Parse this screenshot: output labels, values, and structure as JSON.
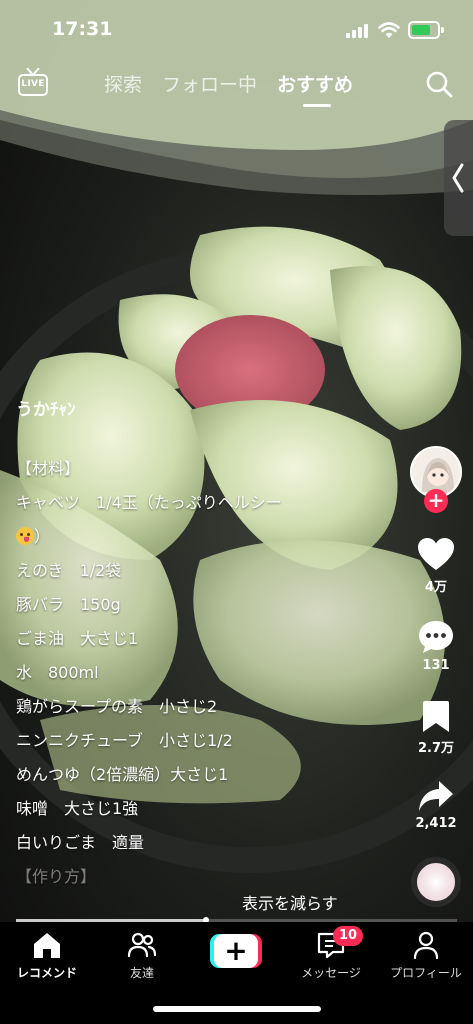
{
  "status_bar": {
    "time": "17:31"
  },
  "top_nav": {
    "live_label": "LIVE",
    "tabs": [
      {
        "label": "探索",
        "active": false
      },
      {
        "label": "フォロー中",
        "active": false
      },
      {
        "label": "おすすめ",
        "active": true
      }
    ]
  },
  "post": {
    "author": "うかﾁｬﾝ",
    "description_lines": [
      "【材料】",
      "キャベツ　1/4玉（たっぷりヘルシー",
      "）",
      "えのき　1/2袋",
      "豚バラ　150g",
      "ごま油　大さじ1",
      "水　800ml",
      "鶏がらスープの素　小さじ2",
      "ニンニクチューブ　小さじ1/2",
      "めんつゆ（2倍濃縮）大さじ1",
      "味噌　大さじ1強",
      "白いりごま　適量",
      "【作り方】"
    ],
    "show_less": "表示を減らす",
    "progress": 0.43
  },
  "actions": {
    "likes": "4万",
    "comments": "131",
    "bookmarks": "2.7万",
    "shares": "2,412"
  },
  "bottom_nav": {
    "home": "レコメンド",
    "friends": "友達",
    "inbox": "メッセージ",
    "inbox_badge": "10",
    "profile": "プロフィール"
  },
  "colors": {
    "accent": "#fe2c55",
    "cyan": "#25f4ee",
    "battery": "#34c759"
  }
}
